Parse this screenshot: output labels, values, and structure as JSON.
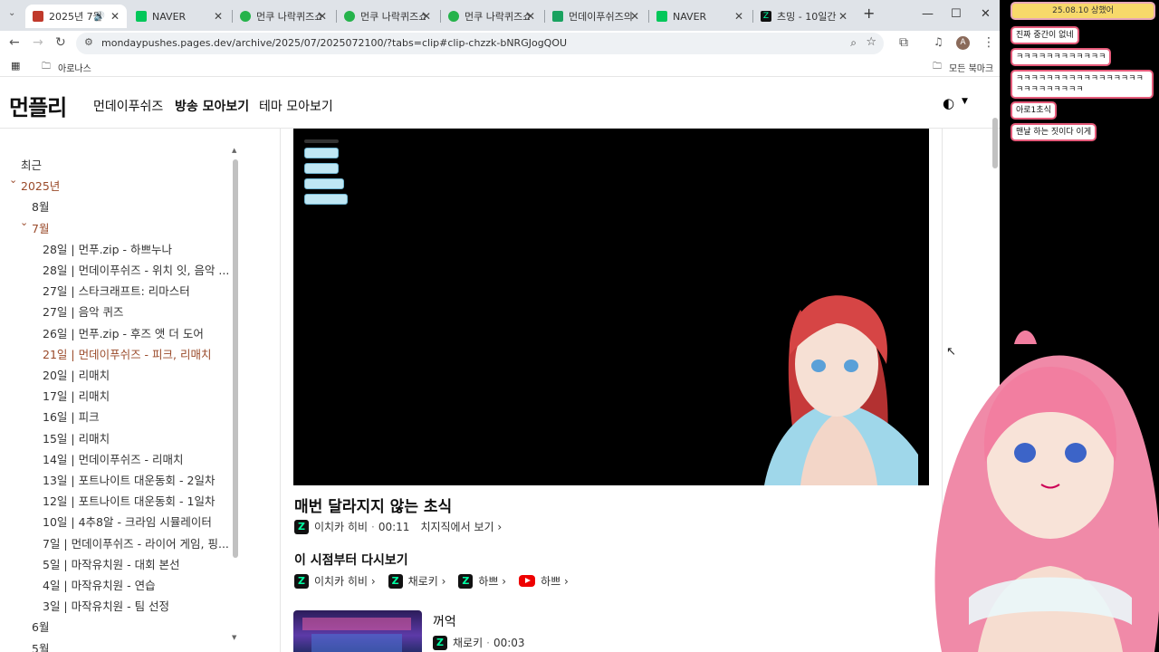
{
  "browser": {
    "tabs": [
      {
        "title": "2025년 7월",
        "favicon_color": "#c0392b",
        "active": true
      },
      {
        "title": "NAVER",
        "favicon_color": "#03c75a"
      },
      {
        "title": "먼쿠 나락퀴즈쇼",
        "favicon_color": "#25b34b"
      },
      {
        "title": "먼쿠 나락퀴즈쇼",
        "favicon_color": "#25b34b"
      },
      {
        "title": "먼쿠 나락퀴즈쇼",
        "favicon_color": "#25b34b"
      },
      {
        "title": "먼데이푸쉬즈의",
        "favicon_color": "#1aa260"
      },
      {
        "title": "NAVER",
        "favicon_color": "#03c75a"
      },
      {
        "title": "츠밍 - 10일간 ",
        "favicon_color": "#111111"
      }
    ],
    "url": "mondaypushes.pages.dev/archive/2025/07/2025072100/?tabs=clip#clip-chzzk-bNRGJogQOU",
    "bookmark_folder": "아로나스",
    "all_bookmarks": "모든 북마크",
    "profile_initial": "A"
  },
  "site": {
    "logo": "먼플리",
    "nav": [
      "먼데이푸쉬즈",
      "방송 모아보기",
      "테마 모아보기"
    ]
  },
  "sidebar": {
    "items": [
      {
        "label": "최근",
        "level": 0
      },
      {
        "label": "2025년",
        "level": 0,
        "accent": true,
        "expanded": true
      },
      {
        "label": "8월",
        "level": 1
      },
      {
        "label": "7월",
        "level": 1,
        "accent": true,
        "expanded": true
      },
      {
        "label": "28일 | 먼푸.zip - 하쁘누나",
        "level": 2
      },
      {
        "label": "28일 | 먼데이푸쉬즈 - 위치 잇, 음악 ...",
        "level": 2
      },
      {
        "label": "27일 | 스타크래프트: 리마스터",
        "level": 2
      },
      {
        "label": "27일 | 음악 퀴즈",
        "level": 2
      },
      {
        "label": "26일 | 먼푸.zip - 후즈 앳 더 도어",
        "level": 2
      },
      {
        "label": "21일 | 먼데이푸쉬즈 - 피크, 리매치",
        "level": 2,
        "accent": true
      },
      {
        "label": "20일 | 리매치",
        "level": 2
      },
      {
        "label": "17일 | 리매치",
        "level": 2
      },
      {
        "label": "16일 | 피크",
        "level": 2
      },
      {
        "label": "15일 | 리매치",
        "level": 2
      },
      {
        "label": "14일 | 먼데이푸쉬즈 - 리매치",
        "level": 2
      },
      {
        "label": "13일 | 포트나이트 대운동회 - 2일차",
        "level": 2
      },
      {
        "label": "12일 | 포트나이트 대운동회 - 1일차",
        "level": 2
      },
      {
        "label": "10일 | 4추8알 - 크라임 시뮬레이터",
        "level": 2
      },
      {
        "label": "7일 | 먼데이푸쉬즈 - 라이어 게임, 핑...",
        "level": 2
      },
      {
        "label": "5일 | 마작유치원 - 대회 본선",
        "level": 2
      },
      {
        "label": "4일 | 마작유치원 - 연습",
        "level": 2
      },
      {
        "label": "3일 | 마작유치원 - 팀 선정",
        "level": 2
      },
      {
        "label": "6월",
        "level": 1
      },
      {
        "label": "5월",
        "level": 1
      }
    ]
  },
  "clip": {
    "title": "매번 달라지지 않는 초식",
    "channel": "이치카 히비",
    "duration": "00:11",
    "watch_link": "치지직에서 보기 ›"
  },
  "rewatch": {
    "heading": "이 시점부터 다시보기",
    "links": [
      {
        "name": "이치카 히비 ›",
        "platform": "chzzk"
      },
      {
        "name": "채로키 ›",
        "platform": "chzzk"
      },
      {
        "name": "하쁘 ›",
        "platform": "chzzk"
      },
      {
        "name": "하쁘 ›",
        "platform": "youtube"
      }
    ]
  },
  "next_clip": {
    "title": "꺼억",
    "channel": "채로키",
    "duration": "00:03"
  },
  "overlay_chat": [
    {
      "text": "25.08.10 상했어",
      "kind": "date"
    },
    {
      "text": "진짜 중간이 없네",
      "kind": "msg"
    },
    {
      "text": "ㅋㅋㅋㅋㅋㅋㅋㅋㅋㅋㅋㅋ",
      "kind": "msg"
    },
    {
      "text": "ㅋㅋㅋㅋㅋㅋㅋㅋㅋㅋㅋㅋㅋㅋㅋㅋㅋㅋㅋㅋㅋㅋㅋㅋㅋㅋ",
      "kind": "msg"
    },
    {
      "text": "아로1초식",
      "kind": "msg"
    },
    {
      "text": "맨날 하는 짓이다 이게",
      "kind": "msg"
    }
  ]
}
